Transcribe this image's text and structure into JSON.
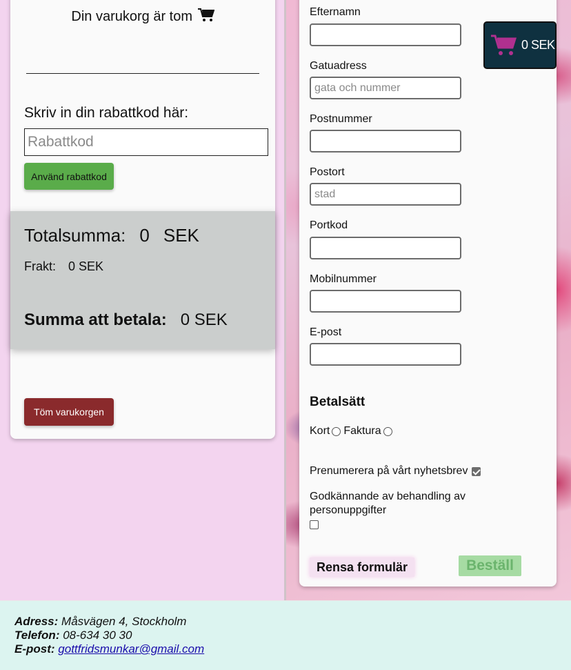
{
  "cart": {
    "empty_text": "Din varukorg är tom",
    "promo_label": "Skriv in din rabattkod här:",
    "promo_placeholder": "Rabattkod",
    "promo_button": "Använd rabattkod",
    "total_label": "Totalsumma:",
    "total_value": "0",
    "total_currency": "SEK",
    "freight_label": "Frakt:",
    "freight_value": "0 SEK",
    "pay_label": "Summa att betala:",
    "pay_value": "0 SEK",
    "empty_button": "Töm varukorgen"
  },
  "form": {
    "fields": [
      {
        "label": "Efternamn",
        "placeholder": "",
        "value": ""
      },
      {
        "label": "Gatuadress",
        "placeholder": "gata och nummer",
        "value": ""
      },
      {
        "label": "Postnummer",
        "placeholder": "",
        "value": ""
      },
      {
        "label": "Postort",
        "placeholder": "stad",
        "value": ""
      },
      {
        "label": "Portkod",
        "placeholder": "",
        "value": ""
      },
      {
        "label": "Mobilnummer",
        "placeholder": "",
        "value": ""
      },
      {
        "label": "E-post",
        "placeholder": "",
        "value": ""
      }
    ],
    "payment_title": "Betalsätt",
    "payment_options": [
      "Kort",
      "Faktura"
    ],
    "newsletter_label": "Prenumerera på vårt nyhetsbrev",
    "newsletter_checked": true,
    "gdpr_label": "Godkännande av behandling av personuppgifter",
    "gdpr_checked": false,
    "reset_button": "Rensa formulär",
    "order_button": "Beställ"
  },
  "cart_badge": {
    "amount": "0 SEK",
    "icon": "shopping-cart-icon",
    "icon_color": "#b0308f",
    "background": "#0f3140"
  },
  "footer": {
    "address_label": "Adress:",
    "address_value": "Måsvägen 4, Stockholm",
    "phone_label": "Telefon:",
    "phone_value": "08-634 30 30",
    "email_label": "E-post:",
    "email_value": "gottfridsmunkar@gmail.com"
  },
  "colors": {
    "promo_button": "#5aac4a",
    "empty_button": "#8a2a2c",
    "order_button": "#a6dba3",
    "footer_bg": "#dcf4f0",
    "page_bg": "#f3d4ef"
  }
}
